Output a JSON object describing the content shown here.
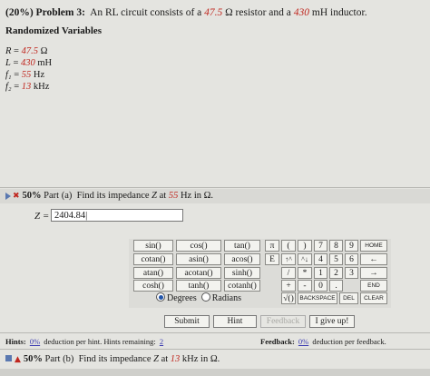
{
  "problem": {
    "prefix": "(20%)",
    "label": "Problem 3:",
    "text_1": "An RL circuit consists of a",
    "resistance": "47.5",
    "text_2": "Ω resistor and a",
    "inductance": "430",
    "text_3": "mH inductor."
  },
  "randomized_title": "Randomized Variables",
  "variables": [
    {
      "name": "R",
      "eq": " = ",
      "value": "47.5",
      "unit": " Ω"
    },
    {
      "name": "L",
      "eq": " = ",
      "value": "430",
      "unit": " mH"
    },
    {
      "name": "f₁",
      "eq": " = ",
      "value": "55",
      "unit": " Hz"
    },
    {
      "name": "f₂",
      "eq": " = ",
      "value": "13",
      "unit": " kHz"
    }
  ],
  "part_a": {
    "percent": "50%",
    "label": "Part (a)",
    "text_1": "Find its impedance",
    "var": "Z",
    "text_2": "at",
    "freq": "55",
    "text_3": "Hz in Ω."
  },
  "answer": {
    "label": "Z =",
    "value": "2404.84"
  },
  "keypad": {
    "funcs": [
      "sin()",
      "cos()",
      "tan()",
      "cotan()",
      "asin()",
      "acos()",
      "atan()",
      "acotan()",
      "sinh()",
      "cosh()",
      "tanh()",
      "cotanh()"
    ],
    "symbols": [
      "π",
      "(",
      ")",
      "E",
      "↑^",
      "^↓",
      "/",
      "*",
      "+",
      "-",
      "0",
      "."
    ],
    "digits": [
      "7",
      "8",
      "9",
      "4",
      "5",
      "6",
      "1",
      "2",
      "3"
    ],
    "nav": [
      "HOME",
      "←",
      "→",
      "END"
    ],
    "sqrt": "√()",
    "backspace": "BACKSPACE",
    "del": "DEL",
    "clear": "CLEAR",
    "degrees": "Degrees",
    "radians": "Radians"
  },
  "buttons": {
    "submit": "Submit",
    "hint": "Hint",
    "feedback": "Feedback",
    "give_up": "I give up!"
  },
  "hints": {
    "label": "Hints:",
    "value": "0%",
    "text": "deduction per hint. Hints remaining:",
    "remaining": "2"
  },
  "feedback": {
    "label": "Feedback:",
    "value": "0%",
    "text": "deduction per feedback."
  },
  "part_b": {
    "percent": "50%",
    "label": "Part (b)",
    "text_1": "Find its impedance",
    "var": "Z",
    "text_2": "at",
    "freq": "13",
    "text_3": "kHz in Ω."
  }
}
